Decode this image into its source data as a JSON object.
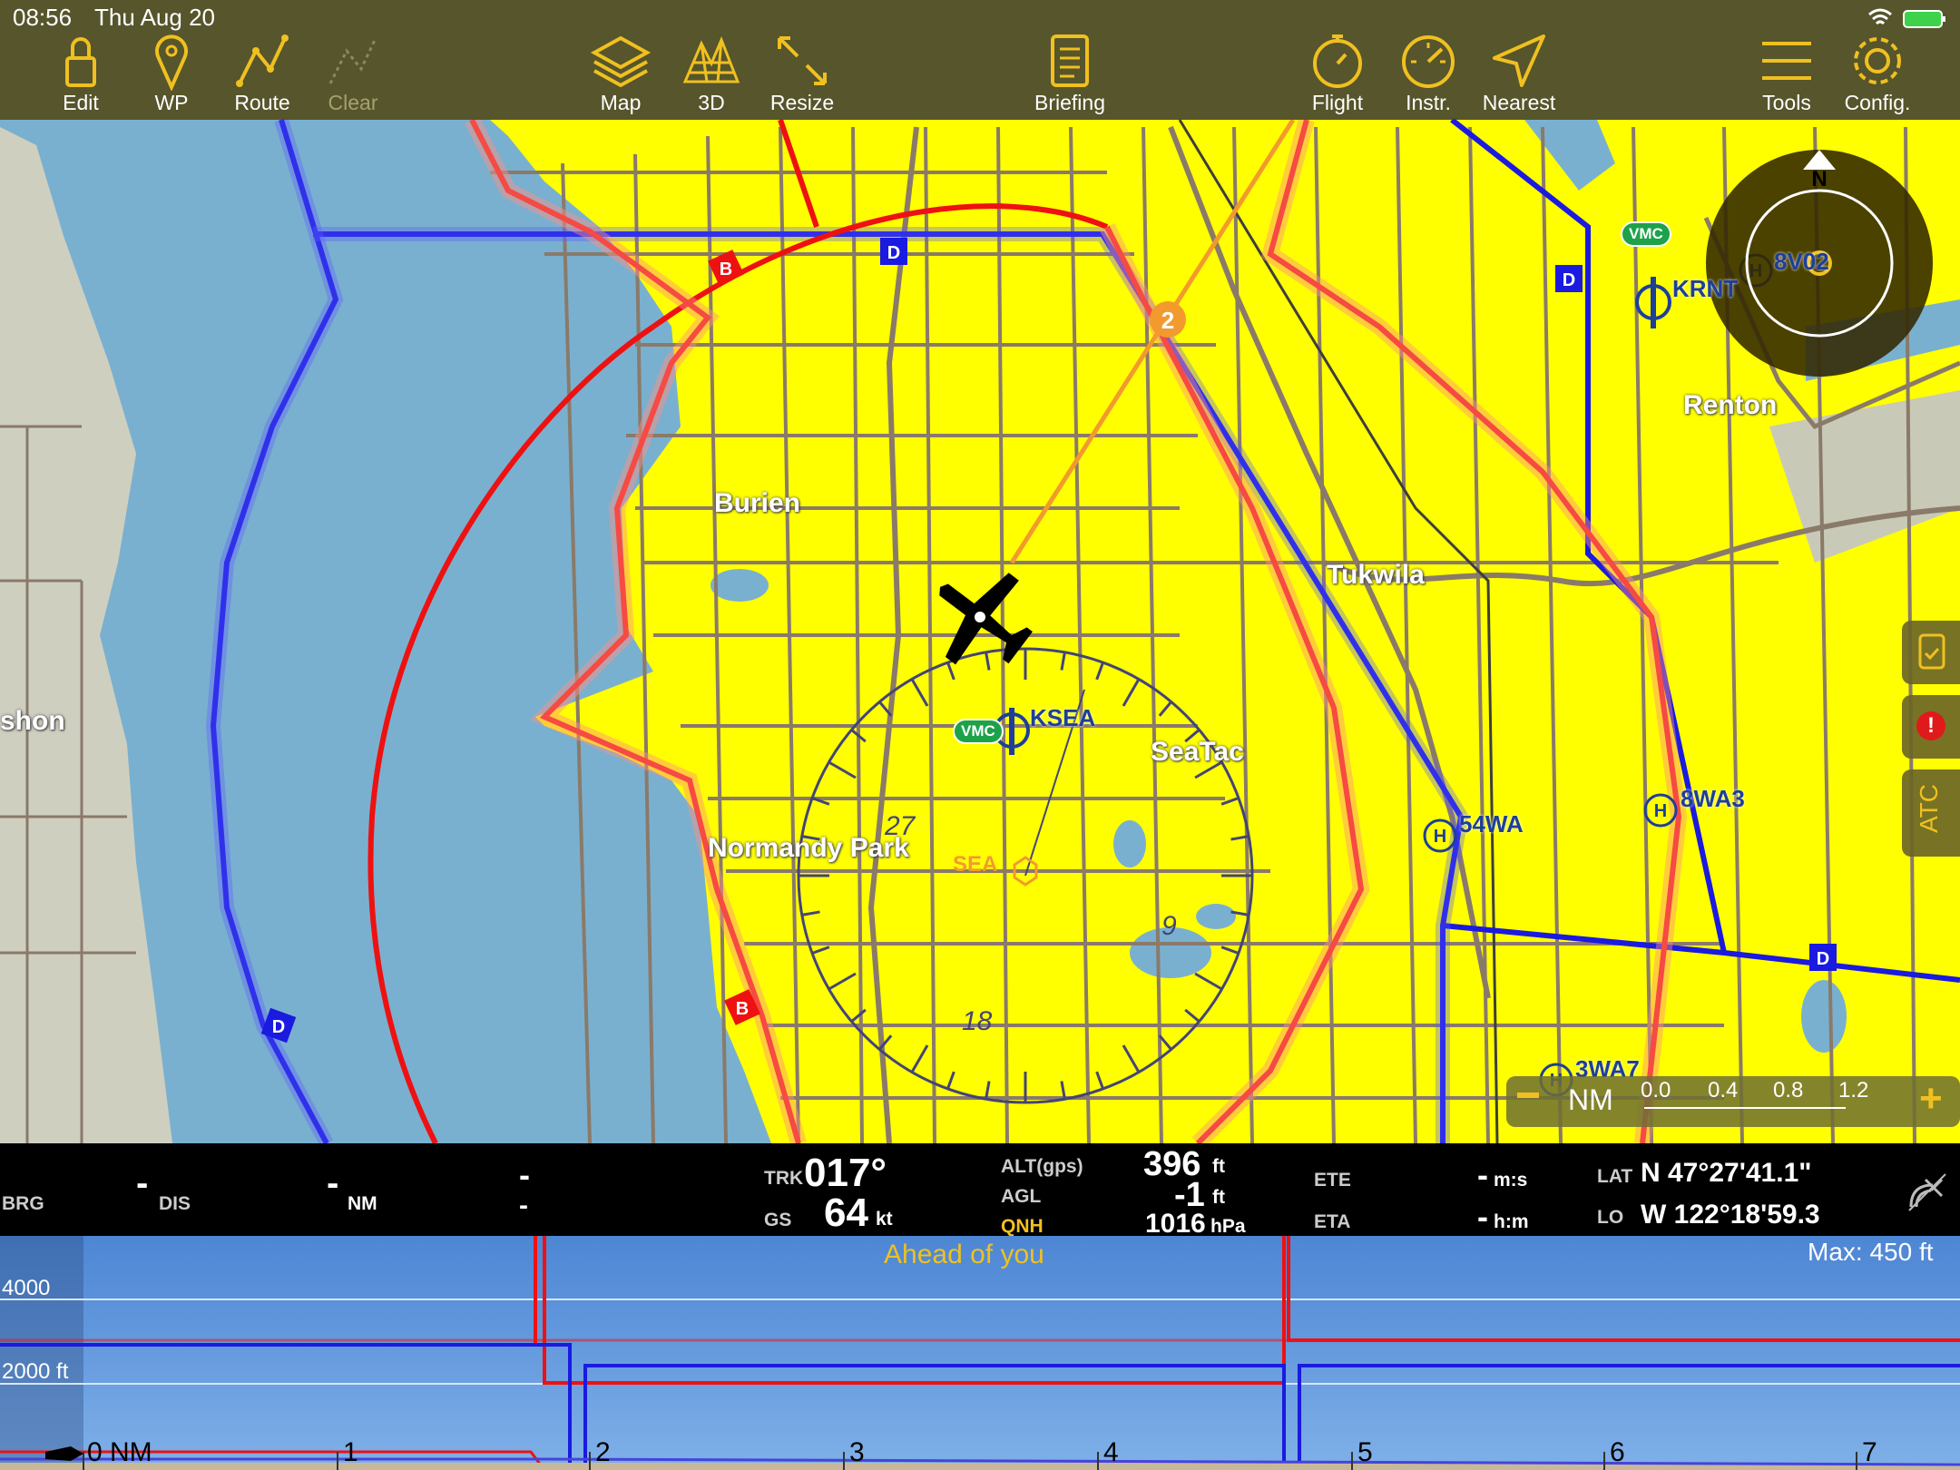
{
  "status": {
    "time": "08:56",
    "date": "Thu Aug 20"
  },
  "toolbar": {
    "edit": "Edit",
    "wp": "WP",
    "route": "Route",
    "clear": "Clear",
    "map": "Map",
    "threed": "3D",
    "resize": "Resize",
    "briefing": "Briefing",
    "flight": "Flight",
    "instr": "Instr.",
    "nearest": "Nearest",
    "tools": "Tools",
    "config": "Config."
  },
  "map": {
    "places": {
      "burien": "Burien",
      "tukwila": "Tukwila",
      "renton": "Renton",
      "seatac": "SeaTac",
      "normandy": "Normandy Park",
      "vashon": "shon"
    },
    "airports": {
      "ksea": "KSEA",
      "krnt": "KRNT",
      "wa54": "54WA",
      "wa8": "8WA3",
      "wa3": "3WA7",
      "v8": "8V02"
    },
    "vmc": "VMC",
    "airspace_class_b": "B",
    "airspace_class_d": "D",
    "vor": "SEA",
    "waypoint_number": "2",
    "compass_rose": [
      "27",
      "18",
      "9"
    ],
    "north": "N",
    "scale": {
      "unit": "NM",
      "ticks": [
        "0.0",
        "0.4",
        "0.8",
        "1.2"
      ]
    },
    "side": {
      "atc": "ATC",
      "alert": "!"
    }
  },
  "data": {
    "brg_label": "BRG",
    "brg": "-",
    "dis_label": "DIS",
    "dis": "-",
    "dis_unit": "NM",
    "dash1": "-",
    "dash2": "-",
    "trk_label": "TRK",
    "trk": "017°",
    "gs_label": "GS",
    "gs": "64",
    "gs_unit": "kt",
    "alt_label": "ALT(gps)",
    "alt": "396",
    "alt_unit": "ft",
    "agl_label": "AGL",
    "agl": "-1",
    "agl_unit": "ft",
    "qnh_label": "QNH",
    "qnh": "1016",
    "qnh_unit": "hPa",
    "ete_label": "ETE",
    "ete": "-",
    "ete_unit": "m:s",
    "eta_label": "ETA",
    "eta": "-",
    "eta_unit": "h:m",
    "lat_label": "LAT",
    "lat": "N 47°27'41.1\"",
    "lon_label": "LO",
    "lon": "W 122°18'59.3"
  },
  "profile": {
    "ahead": "Ahead of you",
    "max": "Max: 450 ft",
    "alt_4000": "4000",
    "alt_2000": "2000 ft",
    "dist_labels": [
      "0 NM",
      "1",
      "2",
      "3",
      "4",
      "5",
      "6",
      "7"
    ]
  },
  "colors": {
    "yellow": "#ffff00",
    "water": "#7ab0cf",
    "land": "#c8c8b8",
    "classB": "#ee1111",
    "classD": "#1a1ae0",
    "road": "#8a7a6a",
    "toolbar": "#50460f",
    "accent": "#f29a2e"
  }
}
